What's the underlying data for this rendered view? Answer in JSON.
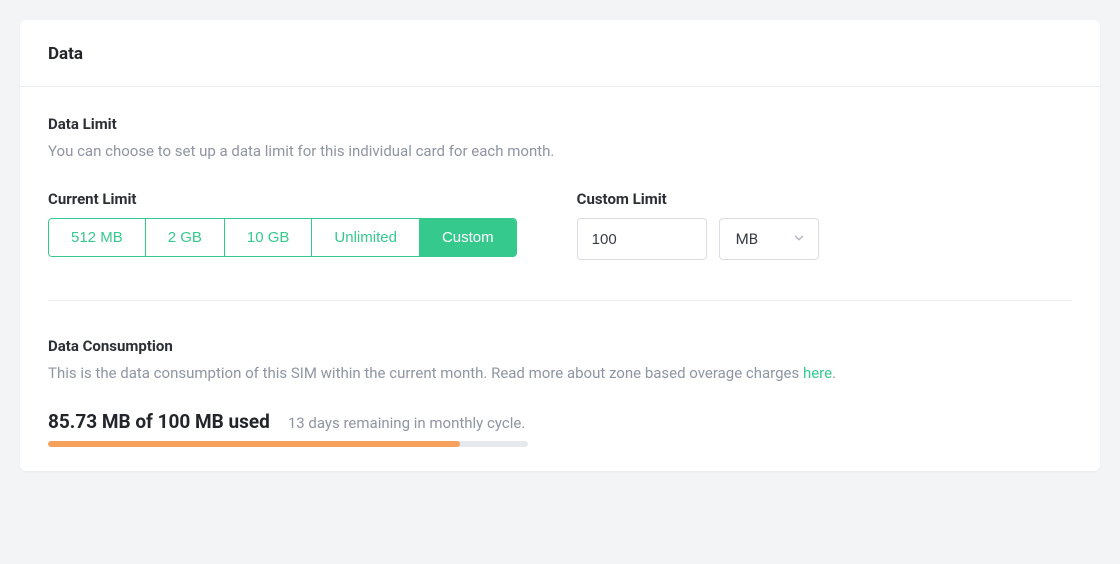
{
  "card": {
    "title": "Data"
  },
  "dataLimit": {
    "heading": "Data Limit",
    "description": "You can choose to set up a data limit for this individual card for each month.",
    "currentLimitLabel": "Current Limit",
    "options": {
      "0": "512 MB",
      "1": "2 GB",
      "2": "10 GB",
      "3": "Unlimited",
      "4": "Custom"
    },
    "customLimitLabel": "Custom Limit",
    "customValue": "100",
    "unit": "MB"
  },
  "consumption": {
    "heading": "Data Consumption",
    "descriptionPrefix": "This is the data consumption of this SIM within the current month. Read more about zone based overage charges ",
    "linkText": "here",
    "descriptionSuffix": ".",
    "usageText": "85.73 MB of 100 MB used",
    "remainingText": "13 days remaining in monthly cycle.",
    "progressPercent": 85.73
  }
}
